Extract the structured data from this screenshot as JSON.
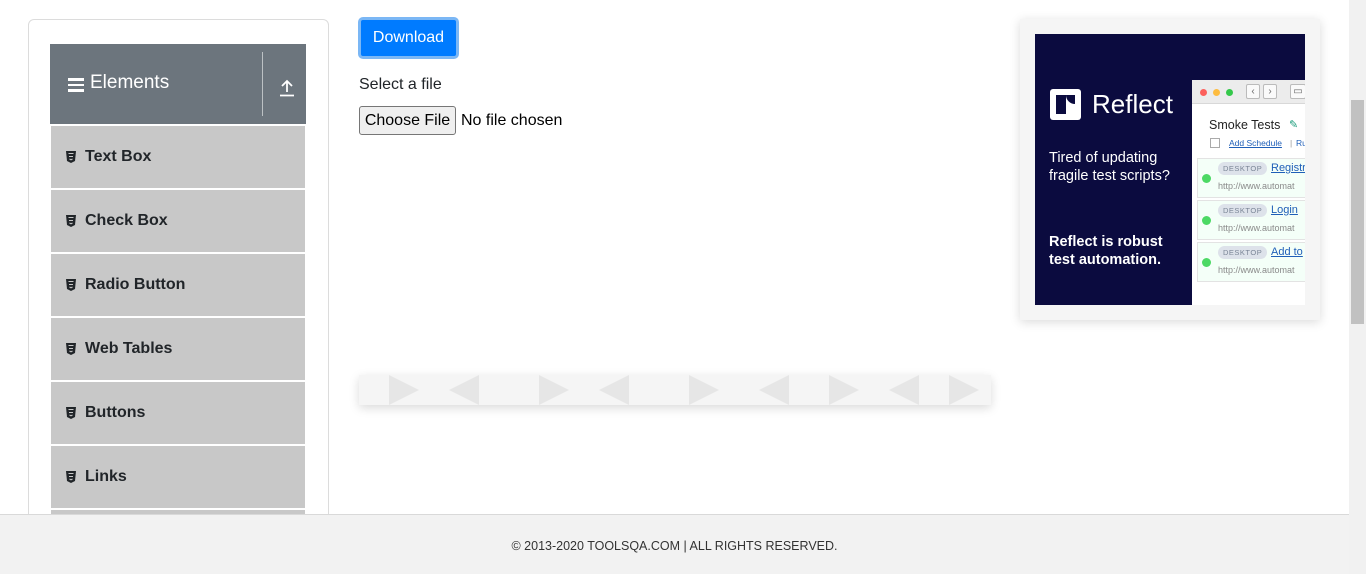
{
  "sidebar": {
    "group_title": "Elements",
    "items": [
      {
        "label": "Text Box"
      },
      {
        "label": "Check Box"
      },
      {
        "label": "Radio Button"
      },
      {
        "label": "Web Tables"
      },
      {
        "label": "Buttons"
      },
      {
        "label": "Links"
      }
    ]
  },
  "main": {
    "download_label": "Download",
    "select_label": "Select a file",
    "choose_file_label": "Choose File",
    "file_status": "No file chosen"
  },
  "ad": {
    "brand": "Reflect",
    "text1": "Tired of updating fragile test scripts?",
    "text2": "Reflect is robust test automation.",
    "mock": {
      "title": "Smoke Tests",
      "add_schedule": "Add Schedule",
      "pipe": "|",
      "run": "Ru",
      "tests": [
        {
          "tag": "DESKTOP",
          "name": "Registr",
          "url": "http://www.automat"
        },
        {
          "tag": "DESKTOP",
          "name": "Login",
          "url": "http://www.automat"
        },
        {
          "tag": "DESKTOP",
          "name": "Add to",
          "url": "http://www.automat"
        }
      ]
    }
  },
  "footer": {
    "text": "© 2013-2020 TOOLSQA.COM | ALL RIGHTS RESERVED."
  },
  "colors": {
    "primary": "#007bff",
    "group_header": "#6c757d",
    "menu_item": "#c8c8c8",
    "ad_background": "#0b0b3f"
  }
}
